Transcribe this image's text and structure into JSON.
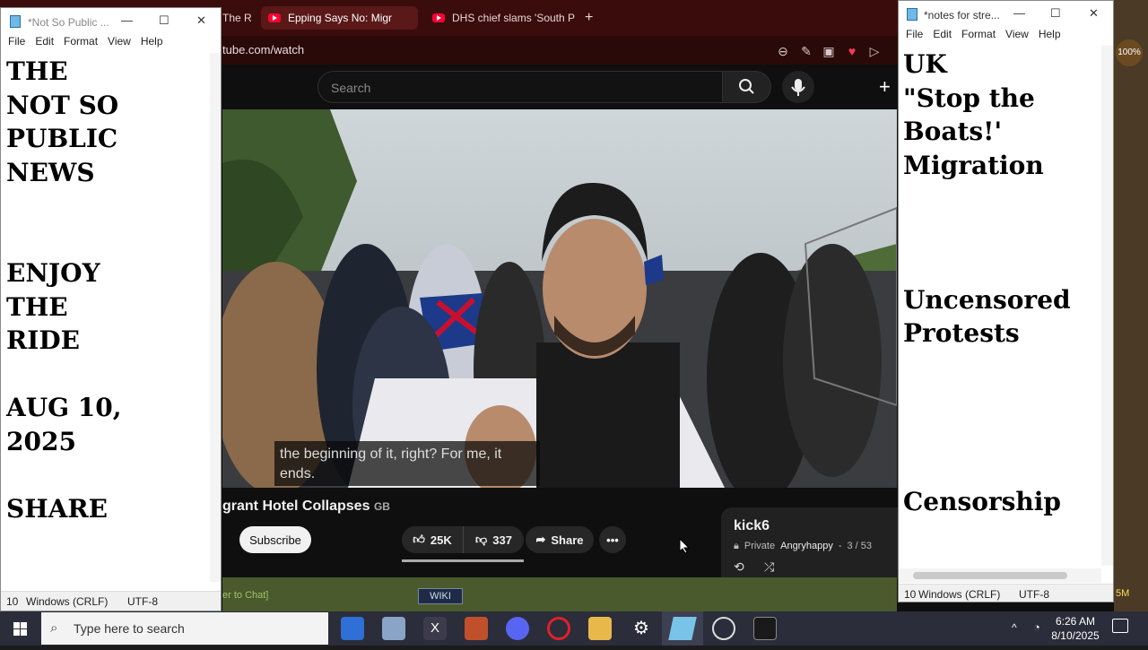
{
  "browser": {
    "tabs": [
      {
        "label": "The R",
        "active": false
      },
      {
        "label": "Epping Says No: Migr",
        "active": true
      },
      {
        "label": "DHS chief slams 'South P",
        "active": false
      }
    ],
    "new_tab_label": "+",
    "url": "tube.com/watch",
    "search_placeholder": "Search",
    "caption_lines": [
      "the beginning of it, right? For me, it",
      "ends."
    ],
    "video_title": "grant Hotel Collapses",
    "country_badge": "GB",
    "subscribe_label": "Subscribe",
    "likes": "25K",
    "dislikes": "337",
    "share_label": "Share",
    "playlist": {
      "name": "kick6",
      "privacy": "Private",
      "owner": "Angryhappy",
      "position": "3 / 53"
    }
  },
  "notepad_left": {
    "title": "*Not So Public ...",
    "menu": [
      "File",
      "Edit",
      "Format",
      "View",
      "Help"
    ],
    "content": "THE\nNOT SO\nPUBLIC\nNEWS\n\n\nENJOY\nTHE\nRIDE\n\nAUG 10,\n2025\n\nSHARE",
    "status_pos": "10",
    "line_ending": "Windows (CRLF)",
    "encoding": "UTF-8"
  },
  "notepad_right": {
    "title": "*notes for stre...",
    "menu": [
      "File",
      "Edit",
      "Format",
      "View",
      "Help"
    ],
    "content": "UK\n\"Stop the\nBoats!'\nMigration\n\n\n\nUncensored\nProtests\n\n\n\n\nCensorship",
    "status_pos": "10",
    "line_ending": "Windows (CRLF)",
    "encoding": "UTF-8"
  },
  "game_overlay": {
    "chat_hint": "er to Chat]",
    "wiki_label": "WIKI",
    "counter": "5M",
    "zoom_badge": "100%"
  },
  "taskbar": {
    "search_placeholder": "Type here to search",
    "time": "6:26 AM",
    "date": "8/10/2025"
  },
  "colors": {
    "youtube_red": "#ff0033",
    "tab_bg": "#3a0c0c",
    "taskbar": "#2b2d3a"
  }
}
